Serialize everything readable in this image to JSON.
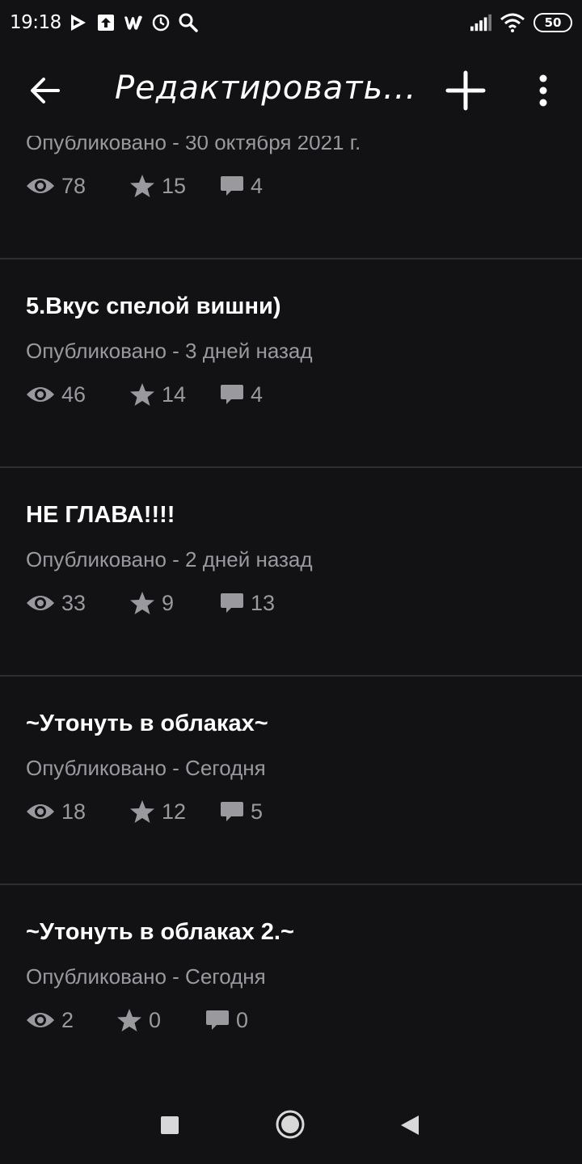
{
  "status_bar": {
    "time": "19:18",
    "battery": "50",
    "icons": [
      "play-store-icon",
      "upload-icon",
      "wattpad-icon",
      "alarm-icon",
      "search-icon",
      "signal-icon",
      "wifi-icon",
      "battery-icon"
    ]
  },
  "app_bar": {
    "title": "Редактировать...",
    "icons": [
      "back-arrow-icon",
      "plus-icon",
      "more-vert-icon"
    ]
  },
  "parts": [
    {
      "title": "",
      "published": "Опубликовано - 30 октября 2021 г.",
      "views": "78",
      "stars": "15",
      "comments": "4"
    },
    {
      "title": "5.Вкус спелой вишни)",
      "published": "Опубликовано - 3 дней назад",
      "views": "46",
      "stars": "14",
      "comments": "4"
    },
    {
      "title": "НЕ ГЛАВА!!!!",
      "published": "Опубликовано - 2 дней назад",
      "views": "33",
      "stars": "9",
      "comments": "13"
    },
    {
      "title": "~Утонуть в облаках~",
      "published": "Опубликовано - Сегодня",
      "views": "18",
      "stars": "12",
      "comments": "5"
    },
    {
      "title": "~Утонуть в облаках 2.~",
      "published": "Опубликовано - Сегодня",
      "views": "2",
      "stars": "0",
      "comments": "0"
    }
  ],
  "nav_bar": {
    "icons": [
      "recents-square-icon",
      "home-circle-icon",
      "back-triangle-icon"
    ]
  },
  "colors": {
    "background": "#121114",
    "divider": "#2e2d31",
    "meta_text": "#9a999e",
    "title_text": "#ffffff"
  }
}
